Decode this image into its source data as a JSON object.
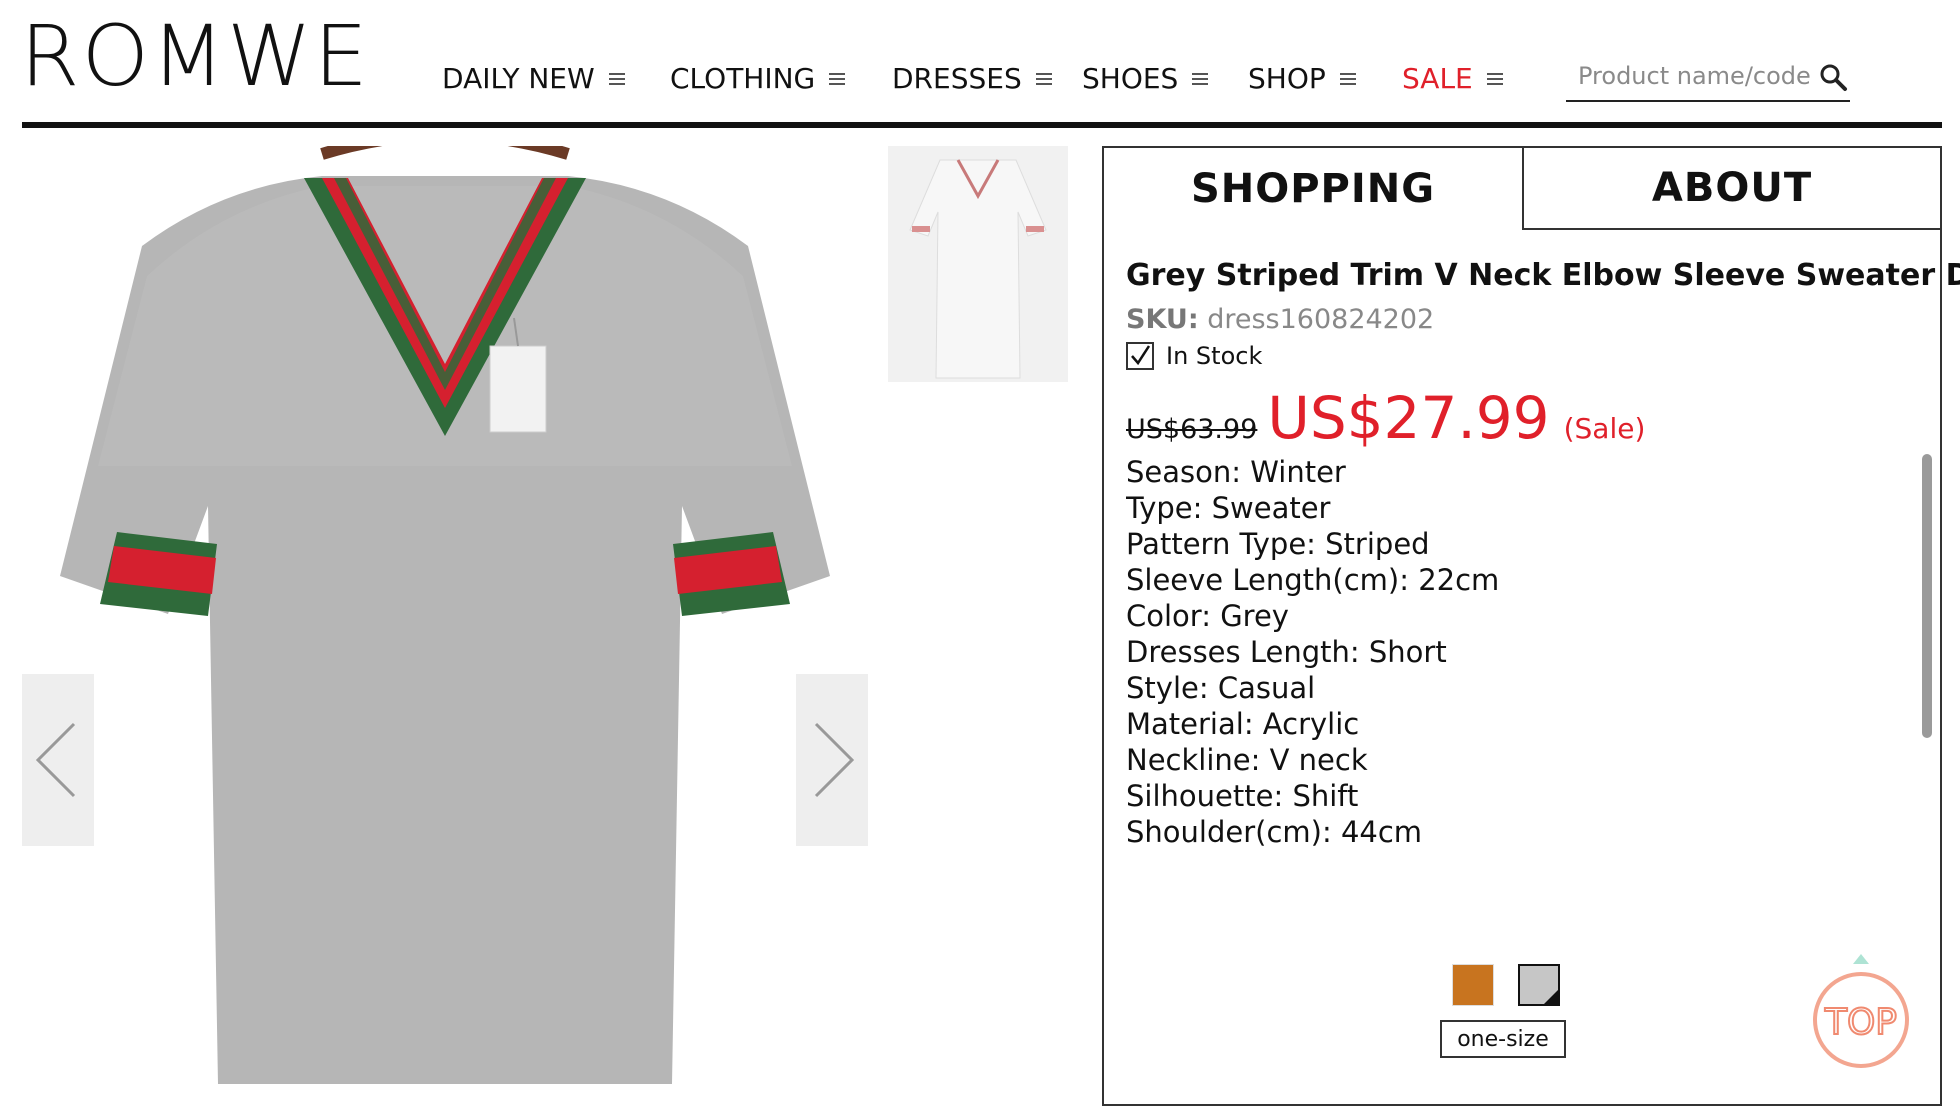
{
  "brand": {
    "logo_text": "ROMWE"
  },
  "nav": {
    "items": [
      {
        "label": "DAILY NEW"
      },
      {
        "label": "CLOTHING"
      },
      {
        "label": "DRESSES"
      },
      {
        "label": "SHOES"
      },
      {
        "label": "SHOP"
      },
      {
        "label": "SALE",
        "color": "#e0202a"
      }
    ]
  },
  "search": {
    "placeholder": "Product name/code"
  },
  "gallery": {
    "main_image": "grey-dress-red-green-striped-trim",
    "thumbnail": "grey-dress-thumbnail",
    "prev_icon": "chevron-left-icon",
    "next_icon": "chevron-right-icon"
  },
  "tabs": [
    {
      "label": "SHOPPING"
    },
    {
      "label": "ABOUT"
    }
  ],
  "product": {
    "title": "Grey Striped Trim V Neck Elbow Sleeve Sweater Dress",
    "sku_label": "SKU:",
    "sku": "dress160824202",
    "stock": "In Stock",
    "old_price": "US$63.99",
    "price": "US$27.99",
    "sale_label": "(Sale)",
    "price_color": "#e0202a",
    "specs": [
      "Season: Winter",
      "Type: Sweater",
      "Pattern Type: Striped",
      "Sleeve Length(cm): 22cm",
      "Color: Grey",
      "Dresses Length: Short",
      "Style: Casual",
      "Material: Acrylic",
      "Neckline: V neck",
      "Silhouette: Shift",
      "Shoulder(cm): 44cm"
    ],
    "swatches": [
      {
        "color": "#c8741f"
      },
      {
        "color": "#c6c6c6"
      }
    ],
    "size": "one-size"
  },
  "top_button": {
    "label": "TOP",
    "color": "#f08a70"
  }
}
